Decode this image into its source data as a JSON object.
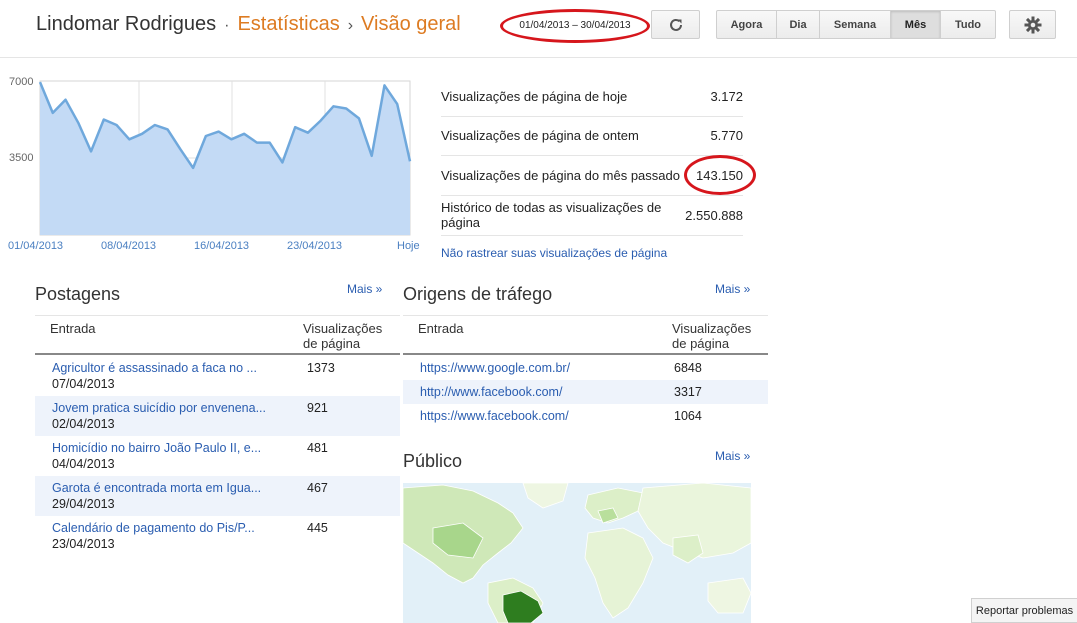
{
  "header": {
    "blog_name": "Lindomar Rodrigues",
    "section": "Estatísticas",
    "page": "Visão geral",
    "date_range": "01/04/2013 – 30/04/2013",
    "periods": [
      "Agora",
      "Dia",
      "Semana",
      "Mês",
      "Tudo"
    ],
    "active_period": "Mês"
  },
  "chart_data": {
    "type": "area",
    "x": [
      "01/04/2013",
      "02/04/2013",
      "03/04/2013",
      "04/04/2013",
      "05/04/2013",
      "06/04/2013",
      "07/04/2013",
      "08/04/2013",
      "09/04/2013",
      "10/04/2013",
      "11/04/2013",
      "12/04/2013",
      "13/04/2013",
      "14/04/2013",
      "15/04/2013",
      "16/04/2013",
      "17/04/2013",
      "18/04/2013",
      "19/04/2013",
      "20/04/2013",
      "21/04/2013",
      "22/04/2013",
      "23/04/2013",
      "24/04/2013",
      "25/04/2013",
      "26/04/2013",
      "27/04/2013",
      "28/04/2013",
      "29/04/2013",
      "30/04/2013"
    ],
    "values": [
      6950,
      5550,
      6150,
      5100,
      3800,
      5250,
      5000,
      4350,
      4600,
      5000,
      4800,
      3900,
      3050,
      4500,
      4700,
      4350,
      4600,
      4200,
      4200,
      3300,
      4900,
      4650,
      5200,
      5850,
      5750,
      5300,
      3600,
      6800,
      5950,
      3350
    ],
    "xticks": [
      "01/04/2013",
      "08/04/2013",
      "16/04/2013",
      "23/04/2013",
      "Hoje"
    ],
    "yticks": [
      "7000",
      "3500"
    ],
    "ylim": [
      0,
      7000
    ],
    "color": "#6fa8dc",
    "fill": "#c3daf5"
  },
  "stats": [
    {
      "label": "Visualizações de página de hoje",
      "value": "3.172"
    },
    {
      "label": "Visualizações de página de ontem",
      "value": "5.770"
    },
    {
      "label": "Visualizações de página do mês passado",
      "value": "143.150"
    },
    {
      "label": "Histórico de todas as visualizações de página",
      "value": "2.550.888"
    }
  ],
  "no_track_link": "Não rastrear suas visualizações de página",
  "posts": {
    "title": "Postagens",
    "more": "Mais »",
    "col1": "Entrada",
    "col2": "Visualizações de página",
    "rows": [
      {
        "title": "Agricultor é assassinado a faca no ...",
        "date": "07/04/2013",
        "views": "1373"
      },
      {
        "title": "Jovem pratica suicídio por envenena...",
        "date": "02/04/2013",
        "views": "921"
      },
      {
        "title": "Homicídio no bairro João Paulo II, e...",
        "date": "04/04/2013",
        "views": "481"
      },
      {
        "title": "Garota é encontrada morta em Igua...",
        "date": "29/04/2013",
        "views": "467"
      },
      {
        "title": "Calendário de pagamento do Pis/P...",
        "date": "23/04/2013",
        "views": "445"
      }
    ]
  },
  "traffic": {
    "title": "Origens de tráfego",
    "more": "Mais »",
    "col1": "Entrada",
    "col2": "Visualizações de página",
    "rows": [
      {
        "source": "https://www.google.com.br/",
        "views": "6848"
      },
      {
        "source": "http://www.facebook.com/",
        "views": "3317"
      },
      {
        "source": "https://www.facebook.com/",
        "views": "1064"
      }
    ]
  },
  "audience": {
    "title": "Público",
    "more": "Mais »"
  },
  "report_button": "Reportar problemas"
}
